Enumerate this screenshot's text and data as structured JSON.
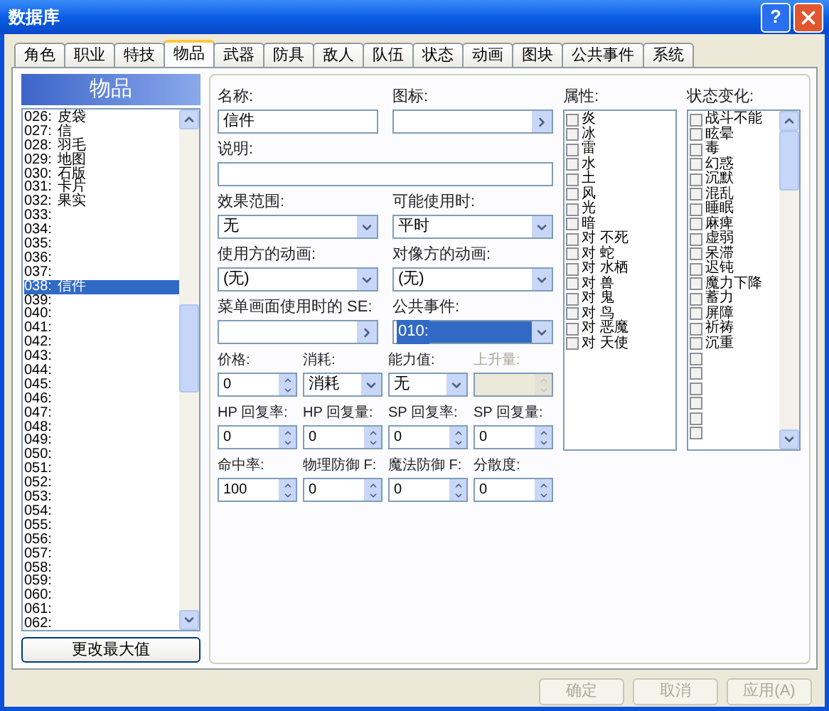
{
  "window": {
    "title": "数据库",
    "help_button": "?"
  },
  "tabs": [
    {
      "label": "角色",
      "selected": false
    },
    {
      "label": "职业",
      "selected": false
    },
    {
      "label": "特技",
      "selected": false
    },
    {
      "label": "物品",
      "selected": true
    },
    {
      "label": "武器",
      "selected": false
    },
    {
      "label": "防具",
      "selected": false
    },
    {
      "label": "敌人",
      "selected": false
    },
    {
      "label": "队伍",
      "selected": false
    },
    {
      "label": "状态",
      "selected": false
    },
    {
      "label": "动画",
      "selected": false
    },
    {
      "label": "图块",
      "selected": false
    },
    {
      "label": "公共事件",
      "selected": false
    },
    {
      "label": "系统",
      "selected": false
    }
  ],
  "item_list": {
    "title": "物品",
    "items": [
      {
        "number": "026:",
        "name": "皮袋",
        "selected": false
      },
      {
        "number": "027:",
        "name": "信",
        "selected": false
      },
      {
        "number": "028:",
        "name": "羽毛",
        "selected": false
      },
      {
        "number": "029:",
        "name": "地图",
        "selected": false
      },
      {
        "number": "030:",
        "name": "石版",
        "selected": false
      },
      {
        "number": "031:",
        "name": "卡片",
        "selected": false
      },
      {
        "number": "032:",
        "name": "果实",
        "selected": false
      },
      {
        "number": "033:",
        "selected": false
      },
      {
        "number": "034:",
        "selected": false
      },
      {
        "number": "035:",
        "selected": false
      },
      {
        "number": "036:",
        "selected": false
      },
      {
        "number": "037:",
        "selected": false
      },
      {
        "number": "038:",
        "name": "信件",
        "selected": true
      },
      {
        "number": "039:",
        "selected": false
      },
      {
        "number": "040:",
        "selected": false
      },
      {
        "number": "041:",
        "selected": false
      },
      {
        "number": "042:",
        "selected": false
      },
      {
        "number": "043:",
        "selected": false
      },
      {
        "number": "044:",
        "selected": false
      },
      {
        "number": "045:",
        "selected": false
      },
      {
        "number": "046:",
        "selected": false
      },
      {
        "number": "047:",
        "selected": false
      },
      {
        "number": "048:",
        "selected": false
      },
      {
        "number": "049:",
        "selected": false
      },
      {
        "number": "050:",
        "selected": false
      },
      {
        "number": "051:",
        "selected": false
      },
      {
        "number": "052:",
        "selected": false
      },
      {
        "number": "053:",
        "selected": false
      },
      {
        "number": "054:",
        "selected": false
      },
      {
        "number": "055:",
        "selected": false
      },
      {
        "number": "056:",
        "selected": false
      },
      {
        "number": "057:",
        "selected": false
      },
      {
        "number": "058:",
        "selected": false
      },
      {
        "number": "059:",
        "selected": false
      },
      {
        "number": "060:",
        "selected": false
      },
      {
        "number": "061:",
        "selected": false
      },
      {
        "number": "062:",
        "selected": false
      }
    ],
    "button": "更改最大值"
  },
  "form": {
    "rows": [
      [
        {
          "kind": "text",
          "label": "名称:",
          "value": "信件",
          "focused": false,
          "disabled": false
        },
        {
          "kind": "picker",
          "label": "图标:",
          "focused": false,
          "disabled": false
        }
      ],
      [
        {
          "kind": "text",
          "label": "说明:",
          "focused": false,
          "disabled": false
        }
      ],
      [
        {
          "kind": "select",
          "label": "效果范围:",
          "value": "无",
          "focused": false,
          "disabled": false
        },
        {
          "kind": "select",
          "label": "可能使用时:",
          "value": "平时",
          "focused": false,
          "disabled": false
        }
      ],
      [
        {
          "kind": "select",
          "label": "使用方的动画:",
          "value": "(无)",
          "focused": false,
          "disabled": false
        },
        {
          "kind": "select",
          "label": "对像方的动画:",
          "value": "(无)",
          "focused": false,
          "disabled": false
        }
      ],
      [
        {
          "kind": "picker",
          "label": "菜单画面使用时的 SE:",
          "focused": false,
          "disabled": false
        },
        {
          "kind": "select",
          "label": "公共事件:",
          "value": "010:",
          "focused": true,
          "disabled": false
        }
      ],
      [
        {
          "kind": "spin",
          "label": "价格:",
          "value": "0",
          "focused": false,
          "disabled": false
        },
        {
          "kind": "select",
          "label": "消耗:",
          "value": "消耗",
          "focused": false,
          "disabled": false
        },
        {
          "kind": "select",
          "label": "能力值:",
          "value": "无",
          "focused": false,
          "disabled": false
        },
        {
          "kind": "spin",
          "label": "上升量:",
          "focused": false,
          "disabled": true
        }
      ],
      [
        {
          "kind": "spin",
          "label": "HP 回复率:",
          "value": "0",
          "focused": false,
          "disabled": false
        },
        {
          "kind": "spin",
          "label": "HP 回复量:",
          "value": "0",
          "focused": false,
          "disabled": false
        },
        {
          "kind": "spin",
          "label": "SP 回复率:",
          "value": "0",
          "focused": false,
          "disabled": false
        },
        {
          "kind": "spin",
          "label": "SP 回复量:",
          "value": "0",
          "focused": false,
          "disabled": false
        }
      ],
      [
        {
          "kind": "spin",
          "label": "命中率:",
          "value": "100",
          "focused": false,
          "disabled": false
        },
        {
          "kind": "spin",
          "label": "物理防御 F:",
          "value": "0",
          "focused": false,
          "disabled": false
        },
        {
          "kind": "spin",
          "label": "魔法防御 F:",
          "value": "0",
          "focused": false,
          "disabled": false
        },
        {
          "kind": "spin",
          "label": "分散度:",
          "value": "0",
          "focused": false,
          "disabled": false
        }
      ]
    ]
  },
  "elements": {
    "label": "属性:",
    "items": [
      {
        "label": "炎",
        "checked": false
      },
      {
        "label": "冰",
        "checked": false
      },
      {
        "label": "雷",
        "checked": false
      },
      {
        "label": "水",
        "checked": false
      },
      {
        "label": "土",
        "checked": false
      },
      {
        "label": "风",
        "checked": false
      },
      {
        "label": "光",
        "checked": false
      },
      {
        "label": "暗",
        "checked": false
      },
      {
        "label": "对 不死",
        "checked": false
      },
      {
        "label": "对 蛇",
        "checked": false
      },
      {
        "label": "对 水栖",
        "checked": false
      },
      {
        "label": "对 兽",
        "checked": false
      },
      {
        "label": "对 鬼",
        "checked": false
      },
      {
        "label": "对 鸟",
        "checked": false
      },
      {
        "label": "对 恶魔",
        "checked": false
      },
      {
        "label": "对 天使",
        "checked": false
      }
    ]
  },
  "states": {
    "label": "状态变化:",
    "items": [
      {
        "label": "战斗不能",
        "checked": false
      },
      {
        "label": "眩晕",
        "checked": false
      },
      {
        "label": "毒",
        "checked": false
      },
      {
        "label": "幻惑",
        "checked": false
      },
      {
        "label": "沉默",
        "checked": false
      },
      {
        "label": "混乱",
        "checked": false
      },
      {
        "label": "睡眠",
        "checked": false
      },
      {
        "label": "麻痺",
        "checked": false
      },
      {
        "label": "虚弱",
        "checked": false
      },
      {
        "label": "呆滞",
        "checked": false
      },
      {
        "label": "迟钝",
        "checked": false
      },
      {
        "label": "魔力下降",
        "checked": false
      },
      {
        "label": "蓄力",
        "checked": false
      },
      {
        "label": "屏障",
        "checked": false
      },
      {
        "label": "祈祷",
        "checked": false
      },
      {
        "label": "沉重",
        "checked": false
      },
      {
        "checked": false
      },
      {
        "checked": false
      },
      {
        "checked": false
      },
      {
        "checked": false
      },
      {
        "checked": false
      },
      {
        "checked": false
      }
    ]
  },
  "buttons": [
    {
      "label": "确定",
      "disabled": true
    },
    {
      "label": "取消",
      "disabled": true
    },
    {
      "label": "应用(A)",
      "disabled": true
    }
  ]
}
